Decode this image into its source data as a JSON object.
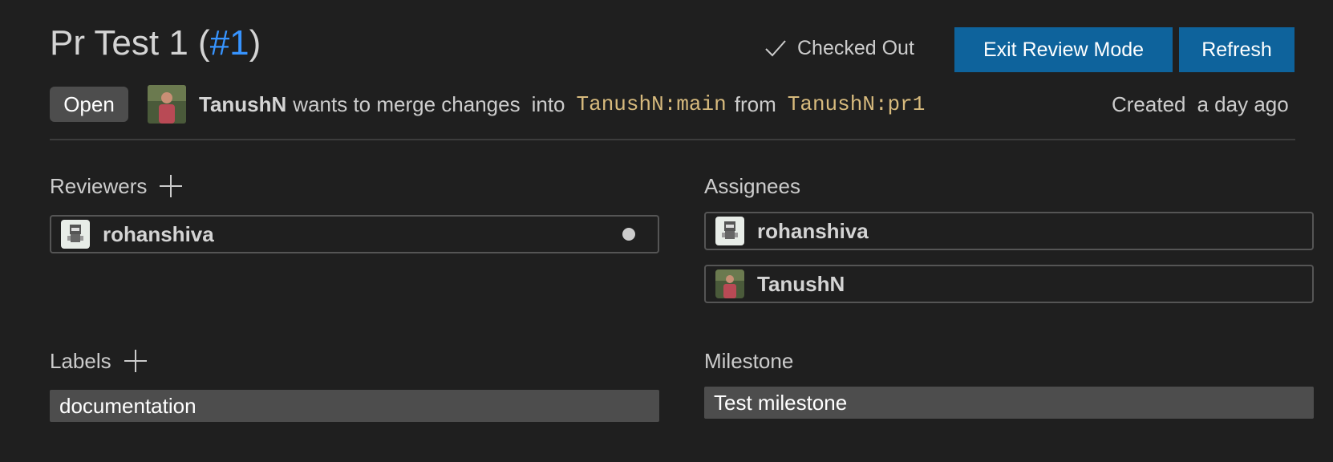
{
  "header": {
    "title_prefix": "Pr Test 1 (",
    "pr_number": "#1",
    "title_suffix": ")",
    "checked_out_label": "Checked Out",
    "exit_review_label": "Exit Review Mode",
    "refresh_label": "Refresh"
  },
  "status": {
    "badge": "Open",
    "author": "TanushN",
    "merge_text": "wants to merge changes",
    "into_label": "into",
    "target_branch": "TanushN:main",
    "from_label": "from",
    "source_branch": "TanushN:pr1",
    "created_label": "Created",
    "created_time": "a day ago"
  },
  "reviewers": {
    "heading": "Reviewers",
    "items": [
      {
        "name": "rohanshiva",
        "status": "pending"
      }
    ]
  },
  "assignees": {
    "heading": "Assignees",
    "items": [
      {
        "name": "rohanshiva"
      },
      {
        "name": "TanushN"
      }
    ]
  },
  "labels": {
    "heading": "Labels",
    "items": [
      "documentation"
    ]
  },
  "milestone": {
    "heading": "Milestone",
    "value": "Test milestone"
  },
  "colors": {
    "background": "#1f1f1f",
    "button": "#0e639c",
    "link": "#3794ff",
    "branch": "#d7ba7d",
    "badge": "#4d4d4d"
  }
}
